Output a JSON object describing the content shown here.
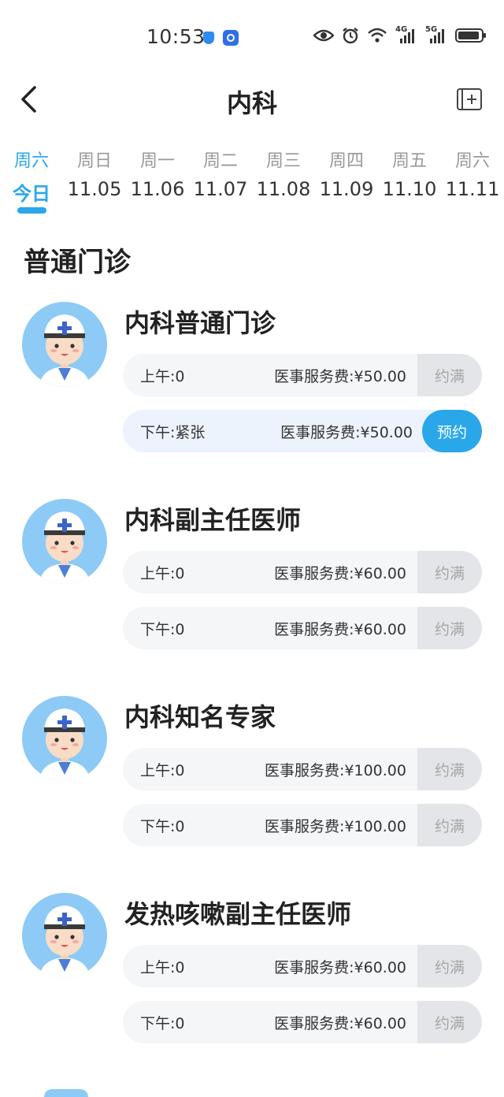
{
  "status_bar": {
    "time": "10:53",
    "icons": [
      "shield-icon",
      "app-icon",
      "eye-icon",
      "alarm-icon",
      "wifi-icon",
      "4g-signal-icon",
      "5g-signal-icon",
      "battery-icon"
    ],
    "net1": "4G",
    "net2": "5G"
  },
  "header": {
    "title": "内科",
    "back_icon": "chevron-left-icon",
    "add_icon": "add-calendar-icon"
  },
  "dates": [
    {
      "weekday": "周六",
      "date": "今日",
      "active": true
    },
    {
      "weekday": "周日",
      "date": "11.05",
      "active": false
    },
    {
      "weekday": "周一",
      "date": "11.06",
      "active": false
    },
    {
      "weekday": "周二",
      "date": "11.07",
      "active": false
    },
    {
      "weekday": "周三",
      "date": "11.08",
      "active": false
    },
    {
      "weekday": "周四",
      "date": "11.09",
      "active": false
    },
    {
      "weekday": "周五",
      "date": "11.10",
      "active": false
    },
    {
      "weekday": "周六",
      "date": "11.11",
      "active": false
    }
  ],
  "section_title": "普通门诊",
  "doctors": [
    {
      "name": "内科普通门诊",
      "slots": [
        {
          "label": "上午:0",
          "fee": "医事服务费:¥50.00",
          "button": "约满",
          "available": false
        },
        {
          "label": "下午:紧张",
          "fee": "医事服务费:¥50.00",
          "button": "预约",
          "available": true
        }
      ]
    },
    {
      "name": "内科副主任医师",
      "slots": [
        {
          "label": "上午:0",
          "fee": "医事服务费:¥60.00",
          "button": "约满",
          "available": false
        },
        {
          "label": "下午:0",
          "fee": "医事服务费:¥60.00",
          "button": "约满",
          "available": false
        }
      ]
    },
    {
      "name": "内科知名专家",
      "slots": [
        {
          "label": "上午:0",
          "fee": "医事服务费:¥100.00",
          "button": "约满",
          "available": false
        },
        {
          "label": "下午:0",
          "fee": "医事服务费:¥100.00",
          "button": "约满",
          "available": false
        }
      ]
    },
    {
      "name": "发热咳嗽副主任医师",
      "slots": [
        {
          "label": "上午:0",
          "fee": "医事服务费:¥60.00",
          "button": "约满",
          "available": false
        },
        {
          "label": "下午:0",
          "fee": "医事服务费:¥60.00",
          "button": "约满",
          "available": false
        }
      ]
    }
  ],
  "colors": {
    "accent": "#2aa7e9",
    "avatar_bg": "#8dcaf6",
    "slot_bg": "#f5f6f8",
    "full_button_bg": "#e4e5e8"
  }
}
